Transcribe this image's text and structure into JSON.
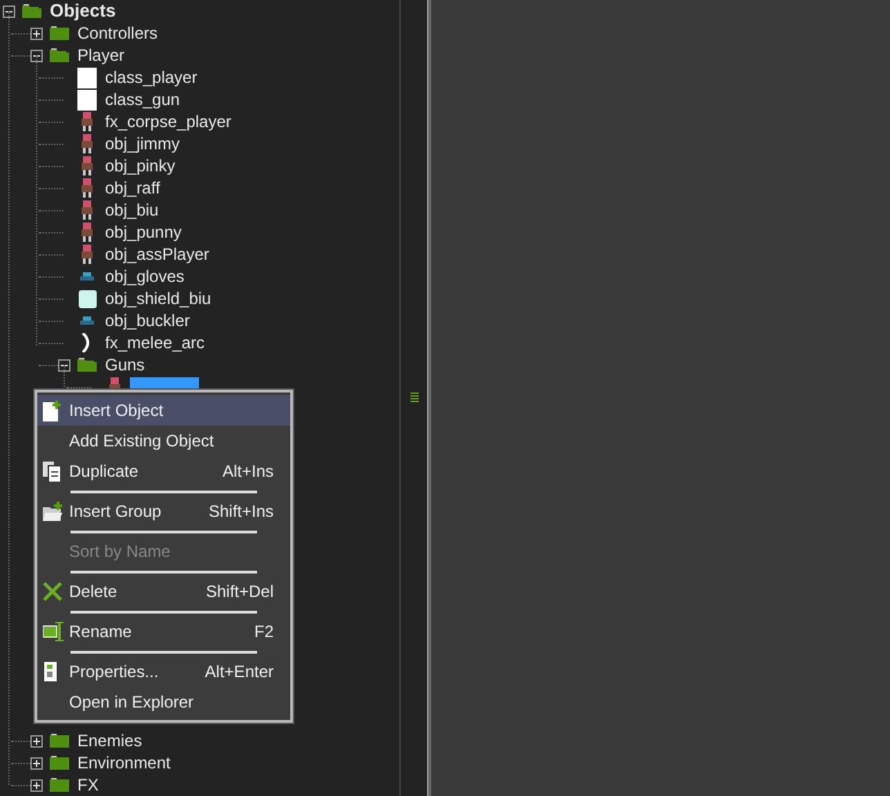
{
  "tree": [
    {
      "label": "Objects",
      "expanded": true,
      "children": [
        {
          "label": "Controllers",
          "expanded": false
        },
        {
          "label": "Player",
          "expanded": true,
          "children": [
            {
              "label": "class_player",
              "kind": "blank"
            },
            {
              "label": "class_gun",
              "kind": "blank"
            },
            {
              "label": "fx_corpse_player",
              "kind": "sprite"
            },
            {
              "label": "obj_jimmy",
              "kind": "sprite"
            },
            {
              "label": "obj_pinky",
              "kind": "sprite"
            },
            {
              "label": "obj_raff",
              "kind": "sprite"
            },
            {
              "label": "obj_biu",
              "kind": "sprite"
            },
            {
              "label": "obj_punny",
              "kind": "sprite"
            },
            {
              "label": "obj_assPlayer",
              "kind": "sprite"
            },
            {
              "label": "obj_gloves",
              "kind": "small"
            },
            {
              "label": "obj_shield_biu",
              "kind": "tile"
            },
            {
              "label": "obj_buckler",
              "kind": "small"
            },
            {
              "label": "fx_melee_arc",
              "kind": "arc"
            },
            {
              "label": "Guns",
              "expanded": true,
              "children": [
                {
                  "kind": "sprite",
                  "selected": true
                }
              ]
            }
          ]
        },
        {
          "label": "Enemies",
          "expanded": false
        },
        {
          "label": "Environment",
          "expanded": false
        },
        {
          "label": "FX",
          "expanded": false
        }
      ]
    }
  ],
  "context_menu": [
    {
      "kind": "new",
      "label": "Insert Object",
      "selected": true,
      "disabled": false
    },
    {
      "kind": "plain",
      "label": "Add Existing Object",
      "selected": false,
      "disabled": false
    },
    {
      "kind": "copy",
      "label": "Duplicate",
      "shortcut": "Alt+Ins",
      "selected": false,
      "disabled": false
    },
    {
      "kind": "separator"
    },
    {
      "kind": "folder",
      "label": "Insert Group",
      "shortcut": "Shift+Ins",
      "selected": false,
      "disabled": false
    },
    {
      "kind": "separator"
    },
    {
      "kind": "plain",
      "label": "Sort by Name",
      "selected": false,
      "disabled": true
    },
    {
      "kind": "separator"
    },
    {
      "kind": "delete",
      "label": "Delete",
      "shortcut": "Shift+Del",
      "selected": false,
      "disabled": false
    },
    {
      "kind": "separator"
    },
    {
      "kind": "rename",
      "label": "Rename",
      "shortcut": "F2",
      "selected": false,
      "disabled": false
    },
    {
      "kind": "separator"
    },
    {
      "kind": "props",
      "label": "Properties...",
      "shortcut": "Alt+Enter",
      "selected": false,
      "disabled": false
    },
    {
      "kind": "plain",
      "label": "Open in Explorer",
      "selected": false,
      "disabled": false
    }
  ]
}
